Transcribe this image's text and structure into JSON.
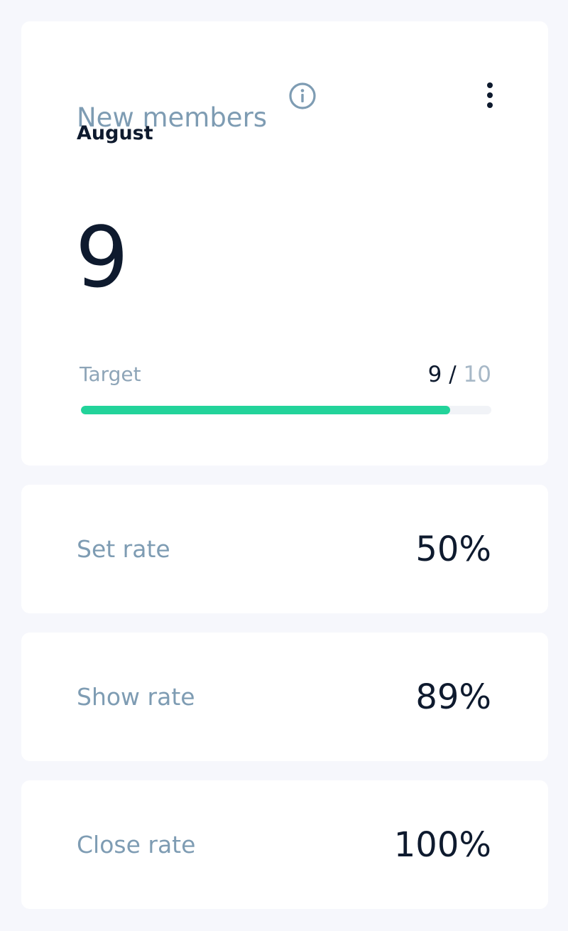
{
  "widget": {
    "title": "New members",
    "info_icon": "info-icon",
    "menu_icon": "more-vertical-icon",
    "period": "August",
    "value": "9",
    "target": {
      "label": "Target",
      "current": "9",
      "separator": " / ",
      "goal": "10",
      "progress_fraction": 0.9
    }
  },
  "rates": [
    {
      "label": "Set rate",
      "value": "50%"
    },
    {
      "label": "Show rate",
      "value": "89%"
    },
    {
      "label": "Close rate",
      "value": "100%"
    }
  ],
  "colors": {
    "page_background": "#f6f7fc",
    "card_background": "#ffffff",
    "label_color": "#7e9cb3",
    "value_color": "#0e1a2e",
    "progress_fill": "#22d39a",
    "progress_track": "#f1f3f7"
  }
}
